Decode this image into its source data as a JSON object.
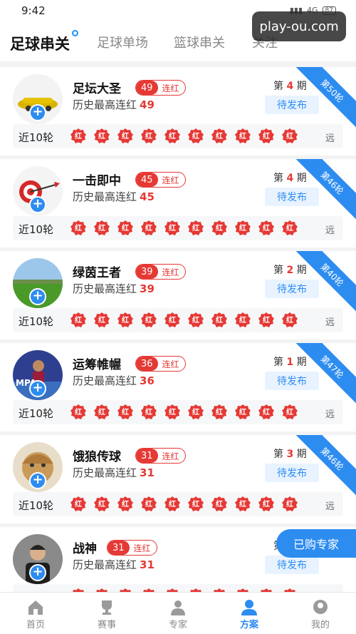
{
  "status_bar": {
    "time": "9:42",
    "network": "4G",
    "battery": "87"
  },
  "watermark": "play-ou.com",
  "tabs": [
    {
      "label": "足球串关",
      "active": true
    },
    {
      "label": "足球单场",
      "active": false
    },
    {
      "label": "篮球串关",
      "active": false
    },
    {
      "label": "关注",
      "active": false
    }
  ],
  "common": {
    "streak_suffix": "连红",
    "history_label": "历史最高连红",
    "period_prefix": "第",
    "period_suffix": "期",
    "status": "待发布",
    "recent_label": "近10轮",
    "badge_text": "红",
    "far_label": "远"
  },
  "experts": [
    {
      "name": "足坛大圣",
      "streak": "49",
      "max_streak": "49",
      "period": "4",
      "round": "第50轮",
      "avatar": "car"
    },
    {
      "name": "一击即中",
      "streak": "45",
      "max_streak": "45",
      "period": "4",
      "round": "第46轮",
      "avatar": "dart"
    },
    {
      "name": "绿茵王者",
      "streak": "39",
      "max_streak": "39",
      "period": "2",
      "round": "第40轮",
      "avatar": "field"
    },
    {
      "name": "运筹帷幄",
      "streak": "36",
      "max_streak": "36",
      "period": "1",
      "round": "第47轮",
      "avatar": "player"
    },
    {
      "name": "饿狼传球",
      "streak": "31",
      "max_streak": "31",
      "period": "3",
      "round": "第46轮",
      "avatar": "face"
    },
    {
      "name": "战神",
      "streak": "31",
      "max_streak": "31",
      "period": "",
      "round": "",
      "avatar": "man"
    }
  ],
  "float_button": "已购专家",
  "nav": [
    {
      "label": "首页",
      "icon": "home-icon",
      "active": false
    },
    {
      "label": "赛事",
      "icon": "trophy-icon",
      "active": false
    },
    {
      "label": "专家",
      "icon": "expert-icon",
      "active": false
    },
    {
      "label": "方案",
      "icon": "plan-icon",
      "active": true
    },
    {
      "label": "我的",
      "icon": "profile-icon",
      "active": false
    }
  ],
  "colors": {
    "accent": "#2d8cf0",
    "red": "#e53935"
  }
}
